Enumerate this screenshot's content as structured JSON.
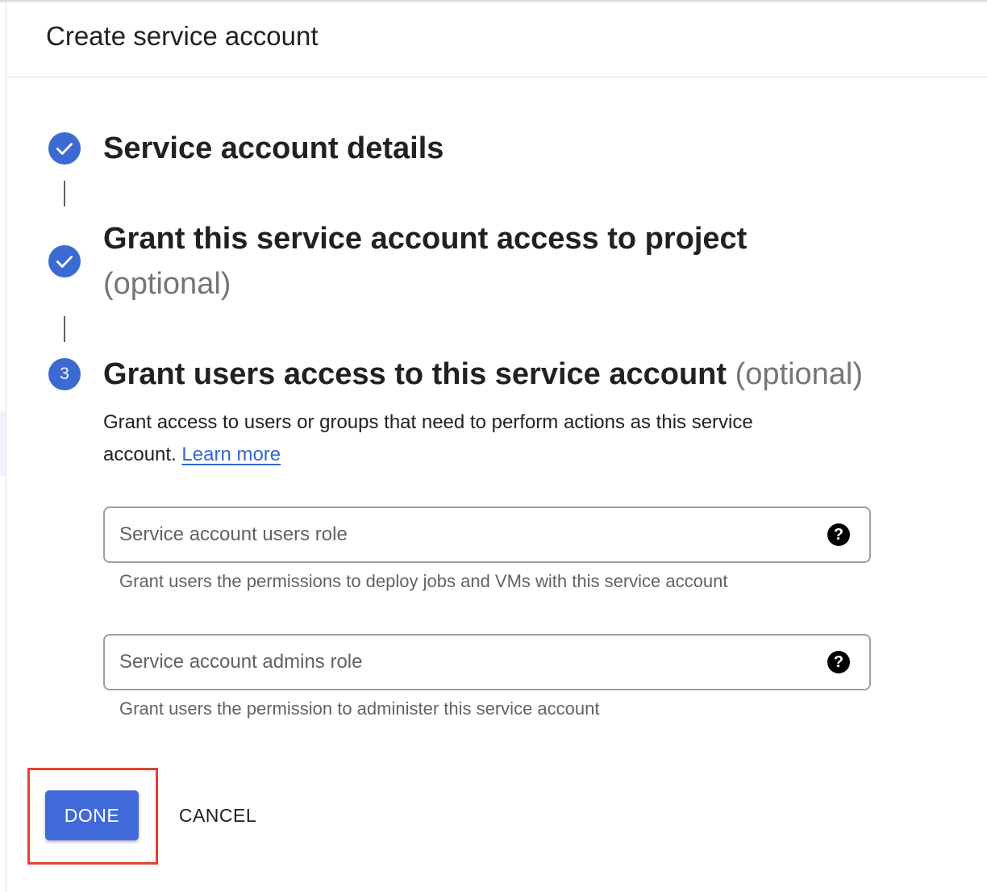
{
  "header": {
    "title": "Create service account"
  },
  "steps": [
    {
      "state": "done",
      "icon": "check-icon",
      "title": "Service account details",
      "optional": ""
    },
    {
      "state": "done",
      "icon": "check-icon",
      "title": "Grant this service account access to project",
      "optional": "(optional)"
    },
    {
      "state": "active",
      "number": "3",
      "title": "Grant users access to this service account",
      "optional": "(optional)"
    }
  ],
  "step3": {
    "description": "Grant access to users or groups that need to perform actions as this service account.",
    "learn_more": "Learn more",
    "fields": [
      {
        "placeholder": "Service account users role",
        "value": "",
        "help_icon": "?",
        "hint": "Grant users the permissions to deploy jobs and VMs with this service account"
      },
      {
        "placeholder": "Service account admins role",
        "value": "",
        "help_icon": "?",
        "hint": "Grant users the permission to administer this service account"
      }
    ]
  },
  "actions": {
    "done": "DONE",
    "cancel": "CANCEL"
  },
  "colors": {
    "accent": "#3c6ad3",
    "primary_button": "#4169d9",
    "link": "#3367d6",
    "highlight_box": "#e1432f"
  }
}
